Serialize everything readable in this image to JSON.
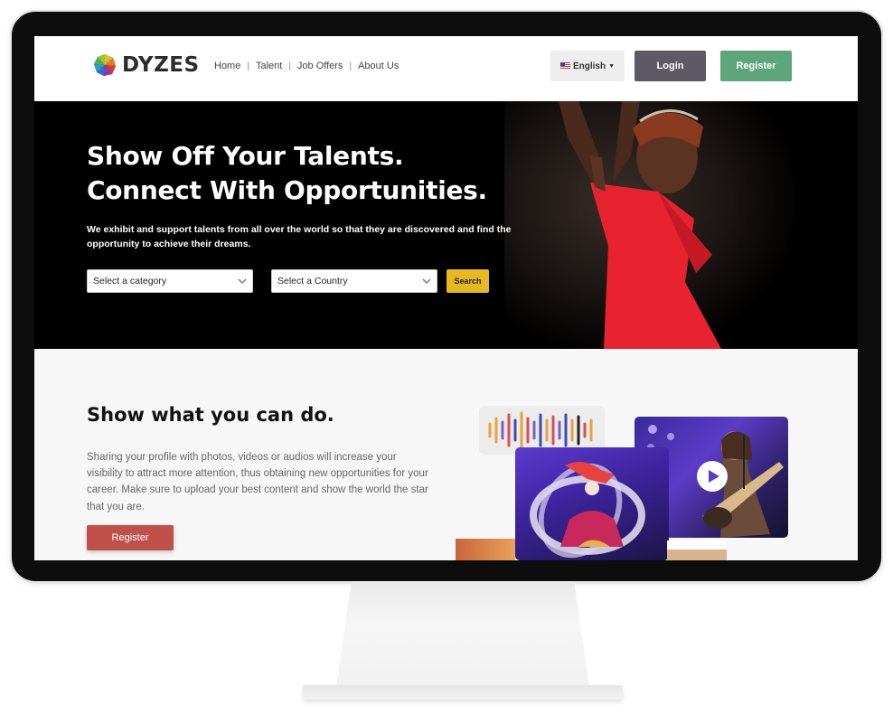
{
  "brand": {
    "name": "DYZES"
  },
  "nav": {
    "items": [
      {
        "label": "Home"
      },
      {
        "label": "Talent"
      },
      {
        "label": "Job Offers"
      },
      {
        "label": "About Us"
      }
    ],
    "language": "English",
    "login_label": "Login",
    "register_label": "Register"
  },
  "hero": {
    "title_line1": "Show Off Your Talents.",
    "title_line2": "Connect With Opportunities.",
    "subtitle": "We exhibit and support talents from all over the world so that they are discovered and find the opportunity to achieve their dreams.",
    "category_placeholder": "Select a category",
    "country_placeholder": "Select a Country",
    "search_label": "Search"
  },
  "section": {
    "title": "Show what you can do.",
    "text": "Sharing your profile with photos, videos or audios will increase your visibility to attract more attention, thus obtaining new opportunities for your career. Make sure to upload your best content and show the world the star that you are.",
    "register_label": "Register"
  },
  "colors": {
    "login": "#5d5a66",
    "register": "#5ea57a",
    "search": "#e7b920",
    "cta": "#c0504a",
    "hero_dress": "#e8232f"
  },
  "icons": [
    "logo-icon",
    "us-flag-icon",
    "chevron-down-icon",
    "play-icon",
    "audio-wave-icon"
  ]
}
